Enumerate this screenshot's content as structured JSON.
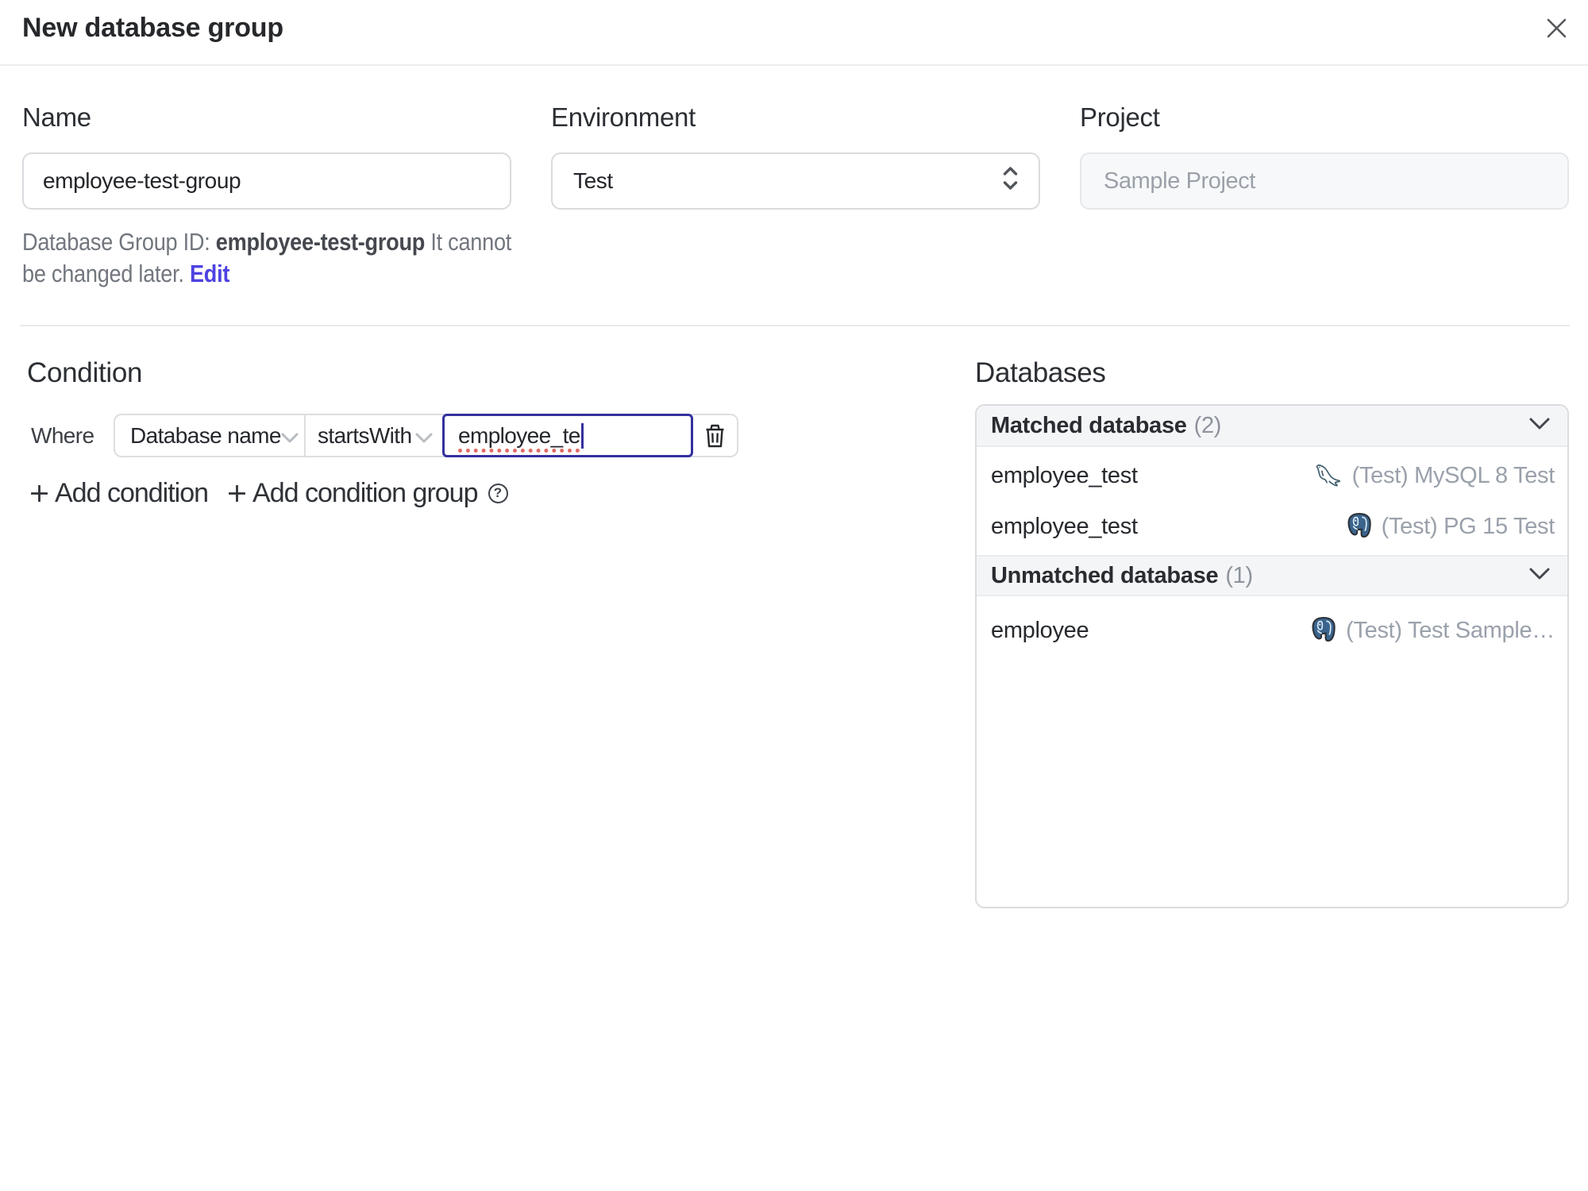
{
  "dialog": {
    "title": "New database group"
  },
  "form": {
    "name": {
      "label": "Name",
      "value": "employee-test-group"
    },
    "environment": {
      "label": "Environment",
      "value": "Test"
    },
    "project": {
      "label": "Project",
      "placeholder": "Sample Project"
    },
    "id_hint": {
      "prefix": "Database Group ID: ",
      "id": "employee-test-group",
      "suffix": " It cannot be changed later. ",
      "edit_label": "Edit"
    }
  },
  "condition": {
    "heading": "Condition",
    "where_label": "Where",
    "factor": "Database name",
    "operator": "startsWith",
    "value": "employee_te",
    "add_condition_label": "Add condition",
    "add_condition_group_label": "Add condition group"
  },
  "databases": {
    "heading": "Databases",
    "groups": [
      {
        "title": "Matched database",
        "count": "(2)",
        "rows": [
          {
            "name": "employee_test",
            "engine": "mysql",
            "instance": "(Test) MySQL 8 Test"
          },
          {
            "name": "employee_test",
            "engine": "postgresql",
            "instance": "(Test) PG 15 Test"
          }
        ]
      },
      {
        "title": "Unmatched database",
        "count": "(1)",
        "rows": [
          {
            "name": "employee",
            "engine": "postgresql",
            "instance": "(Test) Test Sample…"
          }
        ]
      }
    ]
  },
  "colors": {
    "accent_link": "#4e43e1",
    "focus_border": "#33309e",
    "spellcheck_underline": "#e46a65",
    "muted_text": "#9aa1ab",
    "group_header_bg": "#f4f5f7"
  }
}
